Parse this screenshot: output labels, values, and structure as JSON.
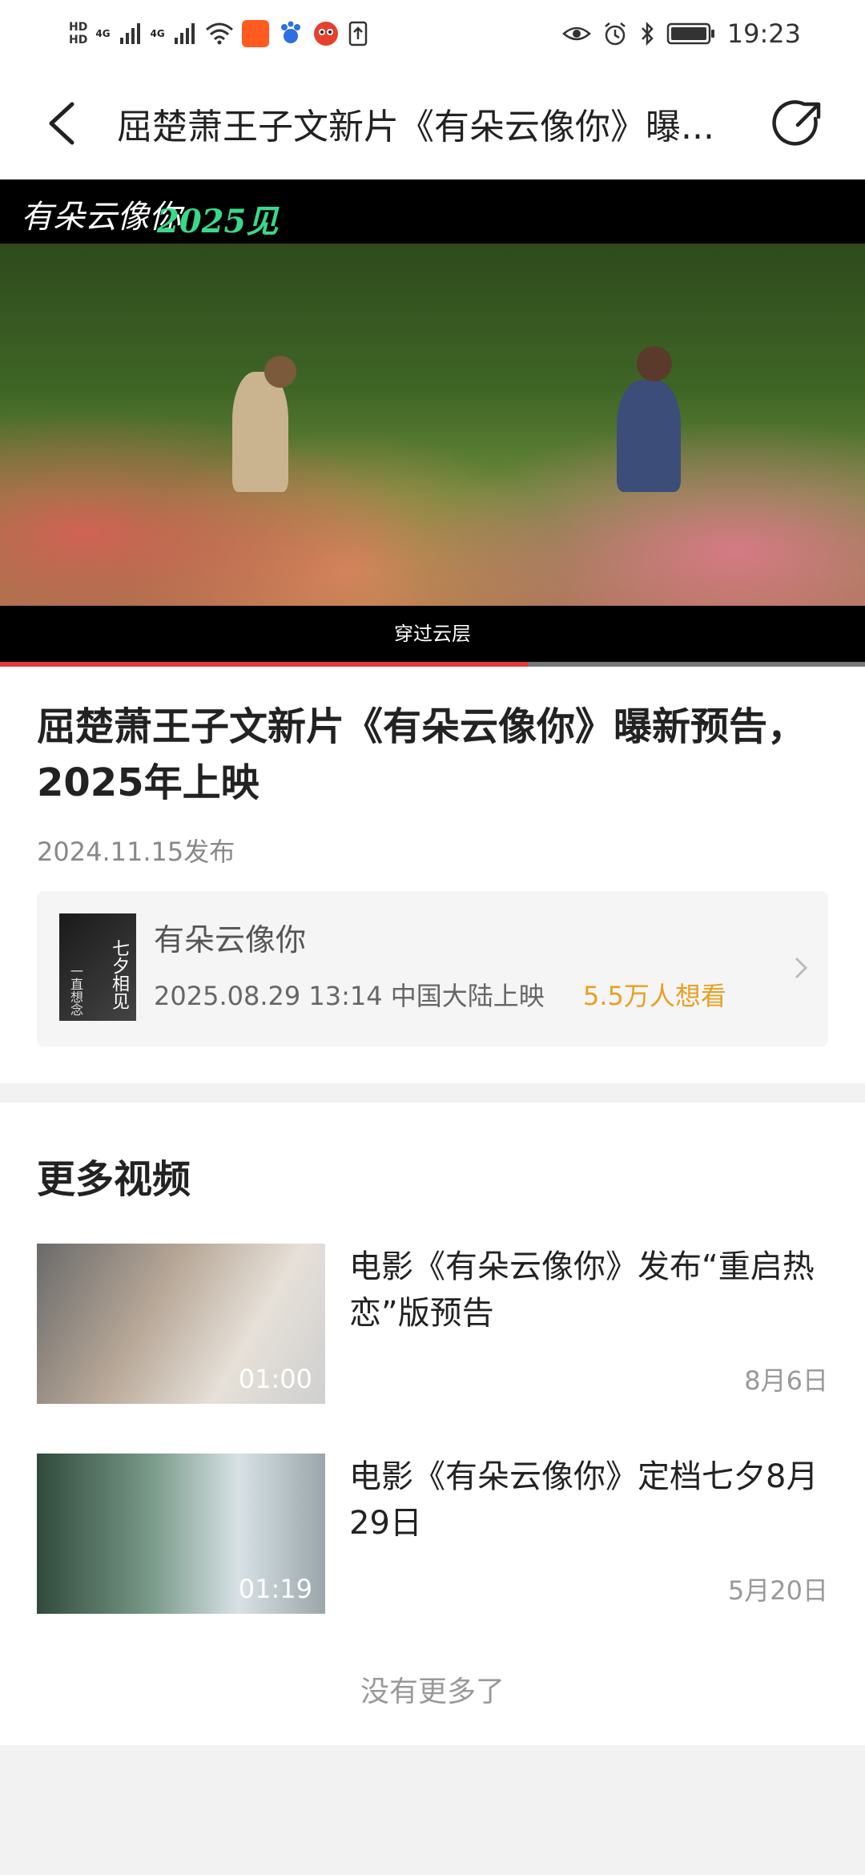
{
  "status_bar": {
    "hd1": "HD",
    "hd2": "HD",
    "net1": "4G",
    "net2": "4G",
    "time": "19:23"
  },
  "nav": {
    "title": "屈楚萧王子文新片《有朵云像你》曝..."
  },
  "video": {
    "logo_script": "有朵云像你",
    "logo_year": "2025见",
    "caption": "穿过云层",
    "progress_fraction": 0.61
  },
  "article": {
    "title": "屈楚萧王子文新片《有朵云像你》曝新预告，2025年上映",
    "date": "2024.11.15发布"
  },
  "movie_card": {
    "name": "有朵云像你",
    "release_info": "2025.08.29 13:14 中国大陆上映",
    "want_count": "5.5万人想看",
    "poster_text_right": "七夕相见",
    "poster_text_left": "一直想念"
  },
  "more_videos": {
    "title": "更多视频",
    "items": [
      {
        "title": "电影《有朵云像你》发布“重启热恋”版预告",
        "duration": "01:00",
        "date": "8月6日"
      },
      {
        "title": "电影《有朵云像你》定档七夕8月29日",
        "duration": "01:19",
        "date": "5月20日"
      }
    ],
    "no_more": "没有更多了"
  },
  "colors": {
    "accent_red": "#e23b3b",
    "want_orange": "#e8a021",
    "logo_green": "#39d98a"
  }
}
